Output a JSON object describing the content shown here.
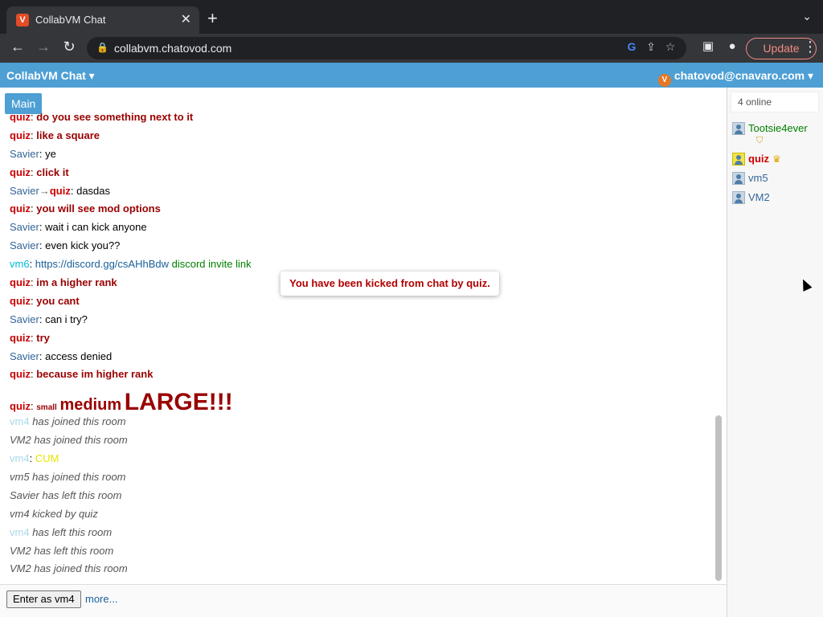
{
  "browser": {
    "tab_title": "CollabVM Chat",
    "tab_favicon": "V",
    "url": "collabvm.chatovod.com",
    "update_label": "Update"
  },
  "header": {
    "brand": "CollabVM Chat ▾",
    "user": "chatovod@cnavaro.com ▾"
  },
  "room_tab": "Main",
  "messages": [
    {
      "nick": "quiz",
      "text": "do you see something next to it",
      "kind": "quiz"
    },
    {
      "nick": "quiz",
      "text": "like a square",
      "kind": "quiz"
    },
    {
      "nick": "Savier",
      "text": "ye",
      "kind": "savier"
    },
    {
      "nick": "quiz",
      "text": "click it",
      "kind": "quiz"
    },
    {
      "nick": "Savier",
      "to": "quiz",
      "text": "dasdas",
      "kind": "private"
    },
    {
      "nick": "quiz",
      "text": "you will see mod options",
      "kind": "quiz"
    },
    {
      "nick": "Savier",
      "text": "wait i can kick anyone",
      "kind": "savier"
    },
    {
      "nick": "Savier",
      "text": "even kick you??",
      "kind": "savier"
    },
    {
      "nick": "vm6",
      "link": "https://discord.gg/csAHhBdw",
      "text": "discord invite link",
      "kind": "vm6"
    },
    {
      "nick": "quiz",
      "text": "im a higher rank",
      "kind": "quiz"
    },
    {
      "nick": "quiz",
      "text": "you cant",
      "kind": "quiz"
    },
    {
      "nick": "Savier",
      "text": "can i try?",
      "kind": "savier"
    },
    {
      "nick": "quiz",
      "text": "try",
      "kind": "quiz"
    },
    {
      "nick": "Savier",
      "text": "access denied",
      "kind": "savier"
    },
    {
      "nick": "quiz",
      "text": "because im higher rank",
      "kind": "quiz"
    },
    {
      "nick": "quiz",
      "small": "small",
      "medium": "medium",
      "large": "LARGE!!!",
      "kind": "sizes"
    },
    {
      "nick": "vm4",
      "text": "has joined this room",
      "kind": "sys-faint"
    },
    {
      "text": "VM2 has joined this room",
      "kind": "sys"
    },
    {
      "nick": "vm4",
      "text": "CUM",
      "kind": "vm4"
    },
    {
      "text": "vm5 has joined this room",
      "kind": "sys"
    },
    {
      "text": "Savier has left this room",
      "kind": "sys"
    },
    {
      "text": "vm4 kicked by quiz",
      "kind": "sys"
    },
    {
      "nick": "vm4",
      "text": "has left this room",
      "kind": "sys-faint"
    },
    {
      "text": "VM2 has left this room",
      "kind": "sys"
    },
    {
      "text": "VM2 has joined this room",
      "kind": "sys"
    }
  ],
  "toast": "You have been kicked from chat by quiz.",
  "bottom": {
    "enter_label": "Enter as vm4",
    "more_label": "more..."
  },
  "sidebar": {
    "online_count": "4 online",
    "users": [
      {
        "name": "Tootsie4ever",
        "style": "green",
        "badge": "shield-icon"
      },
      {
        "name": "quiz",
        "style": "quiz",
        "badge": "crown-icon"
      },
      {
        "name": "vm5",
        "style": "blue"
      },
      {
        "name": "VM2",
        "style": "blue"
      }
    ]
  },
  "colors": {
    "header_bg": "#4d9fd4",
    "quiz_nick": "#cc0000",
    "quiz_text": "#990000",
    "savier_nick": "#336699",
    "toast_text": "#b00000"
  }
}
